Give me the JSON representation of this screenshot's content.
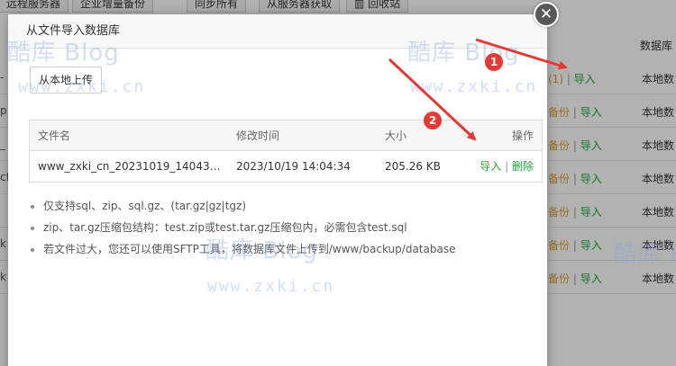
{
  "background": {
    "toolbar": [
      "远程服务器",
      "企业增量备份",
      "同步所有",
      "从服务器获取",
      "回收站"
    ],
    "column_header": "数据库",
    "rows": [
      {
        "left": "-",
        "ops": [
          {
            "text": "(1)",
            "color": "orange"
          },
          {
            "text": "导入",
            "color": "green"
          }
        ],
        "location": "本地数"
      },
      {
        "left": "p",
        "ops": [
          {
            "text": "备份",
            "color": "orange"
          },
          {
            "text": "导入",
            "color": "green"
          }
        ],
        "location": "本地数"
      },
      {
        "left": "_",
        "ops": [
          {
            "text": "备份",
            "color": "orange"
          },
          {
            "text": "导入",
            "color": "green"
          }
        ],
        "location": "本地数"
      },
      {
        "left": "cf",
        "ops": [
          {
            "text": "备份",
            "color": "orange"
          },
          {
            "text": "导入",
            "color": "green"
          }
        ],
        "location": "本地数"
      },
      {
        "left": "",
        "ops": [
          {
            "text": "备份",
            "color": "orange"
          },
          {
            "text": "导入",
            "color": "green"
          }
        ],
        "location": "本地数"
      },
      {
        "left": "k",
        "ops": [
          {
            "text": "备份",
            "color": "orange"
          },
          {
            "text": "导入",
            "color": "green"
          }
        ],
        "location": "本地数"
      },
      {
        "left": "k",
        "ops": [
          {
            "text": "备份",
            "color": "orange"
          },
          {
            "text": "导入",
            "color": "green"
          }
        ],
        "location": "本地数"
      }
    ]
  },
  "modal": {
    "title": "从文件导入数据库",
    "close_glyph": "✕",
    "upload_button": "从本地上传",
    "table": {
      "headers": [
        "文件名",
        "修改时间",
        "大小",
        "操作"
      ],
      "rows": [
        {
          "filename": "www_zxki_cn_20231019_140434.s...",
          "modified": "2023/10/19 14:04:34",
          "size": "205.26 KB",
          "action_import": "导入",
          "action_sep": "|",
          "action_delete": "删除"
        }
      ]
    },
    "tips": [
      "仅支持sql、zip、sql.gz、(tar.gz|gz|tgz)",
      "zip、tar.gz压缩包结构：test.zip或test.tar.gz压缩包内，必需包含test.sql",
      "若文件过大，您还可以使用SFTP工具，将数据库文件上传到/www/backup/database"
    ]
  },
  "annotations": {
    "marker1": "1",
    "marker2": "2",
    "arrow_color": "#e53935"
  },
  "watermark": {
    "logo_text": "酷库 Blog",
    "url_text": "www.zxki.cn"
  },
  "colors": {
    "green": "#20a53a",
    "orange": "#d9a13c",
    "red": "#e53935"
  }
}
